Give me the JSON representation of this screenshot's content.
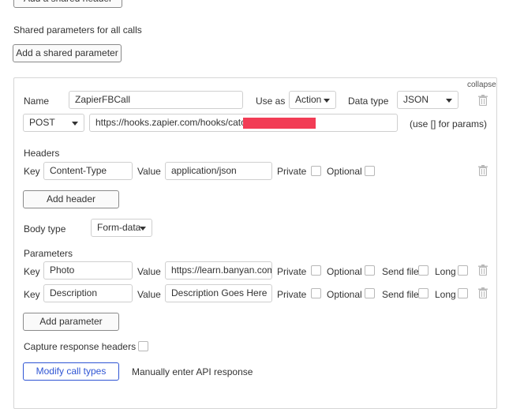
{
  "top": {
    "add_shared_header_label": "Add a shared header",
    "shared_params_heading": "Shared parameters for all calls",
    "add_shared_parameter_label": "Add a shared parameter"
  },
  "call": {
    "collapse_label": "collapse",
    "name_label": "Name",
    "name_value": "ZapierFBCall",
    "use_as_label": "Use as",
    "use_as_value": "Action",
    "data_type_label": "Data type",
    "data_type_value": "JSON",
    "method_value": "POST",
    "url_value": "https://hooks.zapier.com/hooks/catch/",
    "params_hint": "(use [] for params)",
    "headers_heading": "Headers",
    "header_row": {
      "key_label": "Key",
      "key_value": "Content-Type",
      "value_label": "Value",
      "value_value": "application/json",
      "private_label": "Private",
      "optional_label": "Optional"
    },
    "add_header_label": "Add header",
    "body_type_label": "Body type",
    "body_type_value": "Form-data",
    "parameters_heading": "Parameters",
    "parameters": [
      {
        "key_label": "Key",
        "key_value": "Photo",
        "value_label": "Value",
        "value_value": "https://learn.banyan.com/",
        "private_label": "Private",
        "optional_label": "Optional",
        "send_file_label": "Send file",
        "long_label": "Long"
      },
      {
        "key_label": "Key",
        "key_value": "Description",
        "value_label": "Value",
        "value_value": "Description Goes Here",
        "private_label": "Private",
        "optional_label": "Optional",
        "send_file_label": "Send file",
        "long_label": "Long"
      }
    ],
    "add_parameter_label": "Add parameter",
    "capture_headers_label": "Capture response headers",
    "modify_call_types_label": "Modify call types",
    "manual_response_label": "Manually enter API response"
  },
  "colors": {
    "accent_blue": "#2f55d4",
    "redaction_red": "#f23c55",
    "border_gray": "#cfcfcf"
  },
  "icons": [
    "trash-icon",
    "caret-down-icon"
  ]
}
